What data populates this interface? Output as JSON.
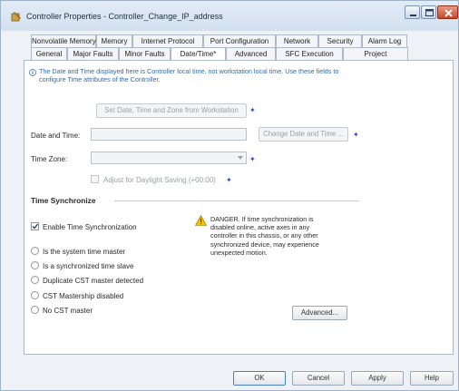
{
  "window": {
    "title": "Controller Properties - Controller_Change_IP_address"
  },
  "tabs_back": [
    {
      "label": "Nonvolatile Memory"
    },
    {
      "label": "Memory"
    },
    {
      "label": "Internet Protocol"
    },
    {
      "label": "Port Configuration"
    },
    {
      "label": "Network"
    },
    {
      "label": "Security"
    },
    {
      "label": "Alarm Log"
    }
  ],
  "tabs_front": [
    {
      "label": "General"
    },
    {
      "label": "Major Faults"
    },
    {
      "label": "Minor Faults"
    },
    {
      "label": "Date/Time*",
      "active": true
    },
    {
      "label": "Advanced"
    },
    {
      "label": "SFC Execution"
    },
    {
      "label": "Project"
    }
  ],
  "info": {
    "text": "The Date and Time displayed here is Controller local time, not workstation local time. Use these fields to configure Time attributes of the Controller."
  },
  "set_from_workstation_label": "Set Date, Time and Zone from Workstation",
  "date_time": {
    "label": "Date and Time:",
    "value": "",
    "change_button": "Change Date and Time ..."
  },
  "time_zone": {
    "label": "Time Zone:",
    "value": ""
  },
  "dst": {
    "label": "Adjust for Daylight Saving (+00:00)",
    "checked": false
  },
  "time_sync": {
    "title": "Time Synchronize",
    "enable_label": "Enable Time Synchronization",
    "enable_checked": true,
    "radios": [
      {
        "label": "Is the system time master"
      },
      {
        "label": "Is a synchronized time slave"
      },
      {
        "label": "Duplicate CST master detected"
      },
      {
        "label": "CST Mastership disabled"
      },
      {
        "label": "No CST master"
      }
    ],
    "danger_text": "DANGER. If time synchronization is disabled online, active axes in any controller in this chassis, or any other synchronized device, may experience unexpected motion.",
    "advanced_button": "Advanced..."
  },
  "footer": {
    "ok": "OK",
    "cancel": "Cancel",
    "apply": "Apply",
    "help": "Help"
  },
  "colors": {
    "info_text": "#2e6cb5",
    "star": "#2a4dbb",
    "warning": "#f2c200"
  }
}
